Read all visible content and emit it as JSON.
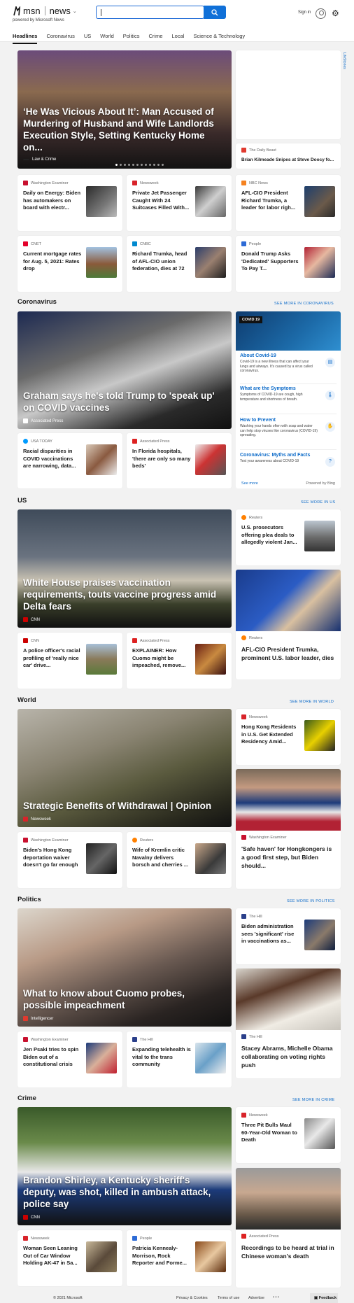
{
  "header": {
    "brand": "msn",
    "section": "news",
    "powered_by": "powered by Microsoft News",
    "search_value": "",
    "sign_in": "Sign in",
    "side_tab": "LifeStories"
  },
  "nav": [
    "Headlines",
    "Coronavirus",
    "US",
    "World",
    "Politics",
    "Crime",
    "Local",
    "Science & Technology"
  ],
  "top": {
    "hero": {
      "title": "‘He Was Vicious About It’: Man Accused of Murdering of Husband and Wife Landlords Execution Style, Setting Kentucky Home on...",
      "source": "Law & Crime"
    },
    "side": {
      "source": "The Daily Beast",
      "title": "Brian Kilmeade Snipes at Steve Doocy fo..."
    },
    "row1": [
      {
        "source": "Washington Examiner",
        "title": "Daily on Energy: Biden has automakers on board with electr..."
      },
      {
        "source": "Newsweek",
        "title": "Private Jet Passenger Caught With 24 Suitcases Filled With..."
      },
      {
        "source": "NBC News",
        "title": "AFL-CIO President Richard Trumka, a leader for labor righ..."
      }
    ],
    "row2": [
      {
        "source": "CNET",
        "title": "Current mortgage rates for Aug. 5, 2021: Rates drop"
      },
      {
        "source": "CNBC",
        "title": "Richard Trumka, head of AFL-CIO union federation, dies at 72"
      },
      {
        "source": "People",
        "title": "Donald Trump Asks 'Dedicated' Supporters To Pay T..."
      }
    ]
  },
  "coronavirus": {
    "heading": "Coronavirus",
    "more": "SEE MORE IN CORONAVIRUS",
    "hero": {
      "title": "Graham says he's told Trump to 'speak up' on COVID vaccines",
      "source": "Associated Press"
    },
    "row": [
      {
        "source": "USA TODAY",
        "title": "Racial disparities in COVID vaccinations are narrowing, data..."
      },
      {
        "source": "Associated Press",
        "title": "In Florida hospitals, 'there are only so many beds'"
      }
    ],
    "panel": {
      "tag": "COVID 19",
      "items": [
        {
          "title": "About Covid-19",
          "text": "Covid-19 is a new illness that can affect your lungs and airways. It's caused by a virus called coronavirus."
        },
        {
          "title": "What are the Symptoms",
          "text": "Symptoms of COVID-19 are cough, high temperature and shortness of breath."
        },
        {
          "title": "How to Prevent",
          "text": "Washing your hands often with soap and water can help stop viruses like coronavirus (COVID-19) spreading."
        },
        {
          "title": "Coronavirus: Myths and Facts",
          "text": "Test your awareness about COVID-19"
        }
      ],
      "see_more": "See more",
      "powered": "Powered by Bing"
    }
  },
  "us": {
    "heading": "US",
    "more": "SEE MORE IN US",
    "hero": {
      "title": "White House praises vaccination requirements, touts vaccine progress amid Delta fears",
      "source": "CNN"
    },
    "side1": {
      "source": "Reuters",
      "title": "U.S. prosecutors offering plea deals to allegedly violent Jan..."
    },
    "side2": {
      "source": "Reuters",
      "title": "AFL-CIO President Trumka, prominent U.S. labor leader, dies"
    },
    "row": [
      {
        "source": "CNN",
        "title": "A police officer's racial profiling of 'really nice car' drive..."
      },
      {
        "source": "Associated Press",
        "title": "EXPLAINER: How Cuomo might be impeached, remove..."
      }
    ]
  },
  "world": {
    "heading": "World",
    "more": "SEE MORE IN WORLD",
    "hero": {
      "title": "Strategic Benefits of Withdrawal | Opinion",
      "source": "Newsweek"
    },
    "side1": {
      "source": "Newsweek",
      "title": "Hong Kong Residents in U.S. Get Extended Residency Amid..."
    },
    "side2": {
      "source": "Washington Examiner",
      "title": "'Safe haven' for Hongkongers is a good first step, but Biden should..."
    },
    "row": [
      {
        "source": "Washington Examiner",
        "title": "Biden's Hong Kong deportation waiver doesn't go far enough"
      },
      {
        "source": "Reuters",
        "title": "Wife of Kremlin critic Navalny delivers borsch and cherries ..."
      }
    ]
  },
  "politics": {
    "heading": "Politics",
    "more": "SEE MORE IN POLITICS",
    "hero": {
      "title": "What to know about Cuomo probes, possible impeachment",
      "source": "Intelligencer"
    },
    "side1": {
      "source": "The Hill",
      "title": "Biden administration sees 'significant' rise in vaccinations as..."
    },
    "side2": {
      "source": "The Hill",
      "title": "Stacey Abrams, Michelle Obama collaborating on voting rights push"
    },
    "row": [
      {
        "source": "Washington Examiner",
        "title": "Jen Psaki tries to spin Biden out of a constitutional crisis"
      },
      {
        "source": "The Hill",
        "title": "Expanding telehealth is vital to the trans community"
      }
    ]
  },
  "crime": {
    "heading": "Crime",
    "more": "SEE MORE IN CRIME",
    "hero": {
      "title": "Brandon Shirley, a Kentucky sheriff's deputy, was shot, killed in ambush attack, police say",
      "source": "CNN"
    },
    "side1": {
      "source": "Newsweek",
      "title": "Three Pit Bulls Maul 60-Year-Old Woman to Death"
    },
    "side2": {
      "source": "Associated Press",
      "title": "Recordings to be heard at trial in Chinese woman's death"
    },
    "row": [
      {
        "source": "Newsweek",
        "title": "Woman Seen Leaning Out of Car Window Holding AK-47 in Sa..."
      },
      {
        "source": "People",
        "title": "Patricia Kennealy-Morrison, Rock Reporter and Forme..."
      }
    ]
  },
  "footer": {
    "copyright": "© 2021 Microsoft",
    "links": [
      "Privacy & Cookies",
      "Terms of use",
      "Advertise"
    ],
    "dots": "• • •",
    "feedback": "Feedback"
  }
}
